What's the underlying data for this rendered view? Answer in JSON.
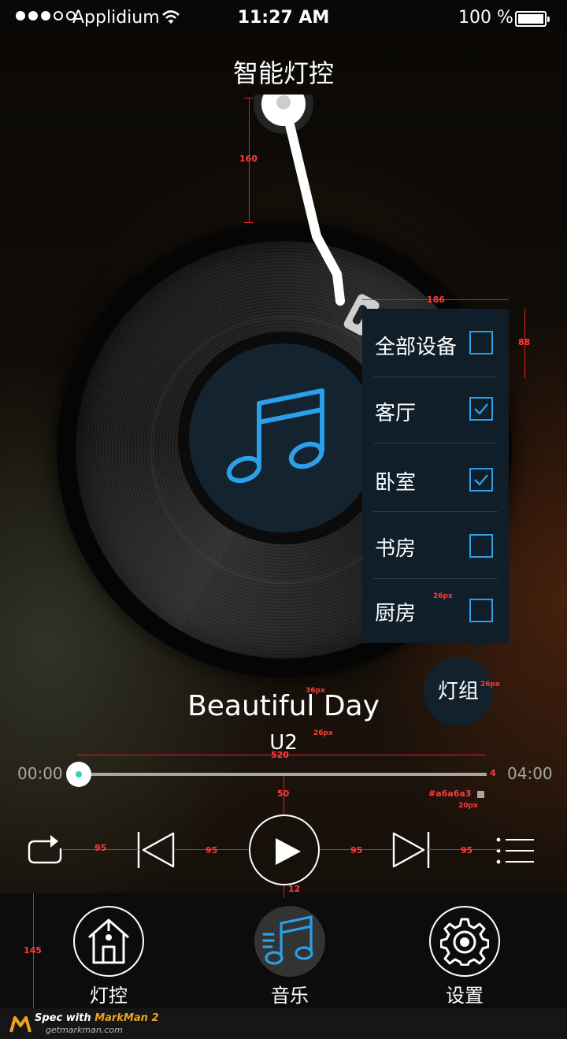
{
  "status_bar": {
    "carrier": "Applidium",
    "time": "11:27 AM",
    "battery": "100 %",
    "signal_dots_filled": 3,
    "signal_dots_total": 5
  },
  "title": "智能灯控",
  "dropdown": {
    "items": [
      {
        "label": "全部设备",
        "checked": false
      },
      {
        "label": "客厅",
        "checked": true
      },
      {
        "label": "卧室",
        "checked": true
      },
      {
        "label": "书房",
        "checked": false
      },
      {
        "label": "厨房",
        "checked": false
      }
    ]
  },
  "group_button": "灯组",
  "song": {
    "title": "Beautiful Day",
    "artist": "U2"
  },
  "progress": {
    "start": "00:00",
    "end": "04:00",
    "fraction": 0.0
  },
  "tabs": [
    {
      "label": "灯控",
      "icon": "home-icon"
    },
    {
      "label": "音乐",
      "icon": "music-icon"
    },
    {
      "label": "设置",
      "icon": "gear-icon"
    }
  ],
  "colors": {
    "accent": "#2b9fe8",
    "track": "#a6a6a3",
    "annotation": "#e02020"
  },
  "spec_annotations": {
    "a160": "160",
    "a186": "186",
    "a88": "88",
    "a26_dropdown": "26px",
    "a26_group": "26px",
    "a36": "36px",
    "a26_artist": "26px",
    "a520": "520",
    "a4": "4",
    "color_hex": "#a6a6a3",
    "a20": "20px",
    "a50": "50",
    "a95_1": "95",
    "a95_2": "95",
    "a95_3": "95",
    "a95_4": "95",
    "a12": "12",
    "a145": "145"
  },
  "footer": {
    "spec_prefix": "Spec with ",
    "brand": "MarkMan 2",
    "url": "getmarkman.com"
  }
}
